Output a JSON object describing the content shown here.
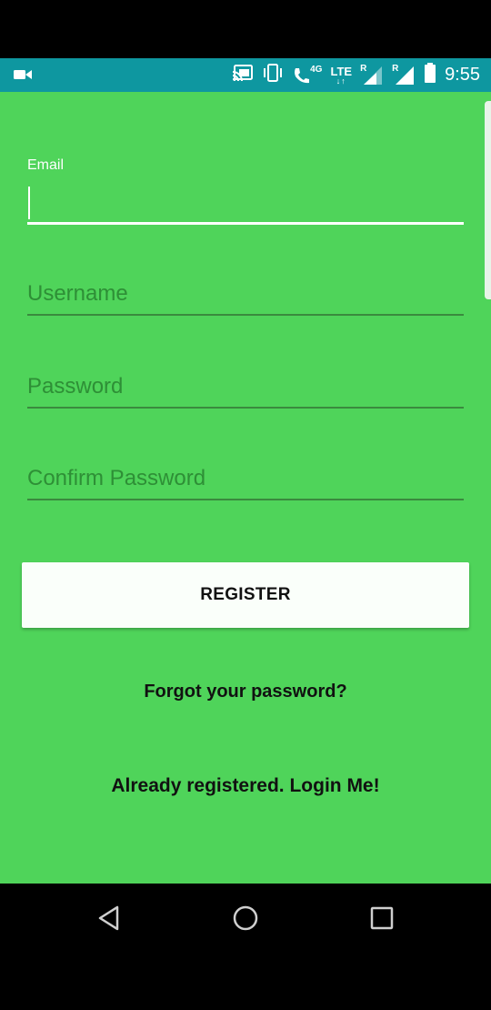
{
  "status_bar": {
    "time": "9:55",
    "network_4g": "4G",
    "network_lte": "LTE",
    "roaming_1": "R",
    "roaming_2": "R",
    "icons": [
      "video-camera-icon",
      "cast-icon",
      "vibrate-icon",
      "wifi-calling-icon",
      "signal-icon",
      "battery-icon"
    ]
  },
  "form": {
    "email_label": "Email",
    "email_value": "",
    "username_placeholder": "Username",
    "password_placeholder": "Password",
    "confirm_password_placeholder": "Confirm Password",
    "register_label": "REGISTER",
    "forgot_password": "Forgot your password?",
    "login_link": "Already registered. Login Me!"
  },
  "nav_bar": {
    "icons": [
      "back-icon",
      "home-icon",
      "recents-icon"
    ]
  },
  "colors": {
    "background": "#4fd45a",
    "status_bar": "#0e97a0",
    "button": "#fafffa"
  }
}
